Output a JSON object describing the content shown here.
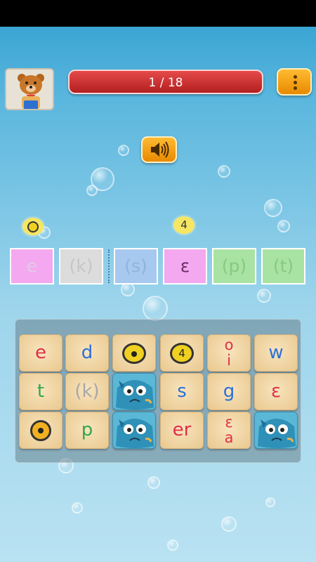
{
  "progress": {
    "label": "1 / 18",
    "current": 1,
    "total": 18
  },
  "hints": [
    {
      "id": "dot",
      "text": ""
    },
    {
      "id": "tone",
      "text": "4"
    }
  ],
  "answer_slots": [
    {
      "text": "e",
      "bg": "#f3a8f0",
      "fg": "#e6c9e4"
    },
    {
      "text": "(k)",
      "bg": "#dcdcdc",
      "fg": "#c6c6c6"
    },
    {
      "text": "(s)",
      "bg": "#a7c9f0",
      "fg": "#8fb4de"
    },
    {
      "text": "ε",
      "bg": "#f3a8f0",
      "fg": "#6a2f66"
    },
    {
      "text": "(p)",
      "bg": "#a9e3a3",
      "fg": "#86c983"
    },
    {
      "text": "(t)",
      "bg": "#a9e3a3",
      "fg": "#86c983"
    }
  ],
  "tiles": [
    {
      "type": "text",
      "text": "e",
      "color": "#e0304a"
    },
    {
      "type": "text",
      "text": "d",
      "color": "#2d6fd8"
    },
    {
      "type": "dot"
    },
    {
      "type": "tone",
      "text": "4"
    },
    {
      "type": "stack",
      "top": "o",
      "bottom": "i",
      "color": "#e0304a"
    },
    {
      "type": "text",
      "text": "w",
      "color": "#2d6fd8"
    },
    {
      "type": "text",
      "text": "t",
      "color": "#2fa84a"
    },
    {
      "type": "text",
      "text": "(k)",
      "color": "#a8a8a8"
    },
    {
      "type": "fish"
    },
    {
      "type": "text",
      "text": "s",
      "color": "#2d6fd8"
    },
    {
      "type": "text",
      "text": "g",
      "color": "#2d6fd8"
    },
    {
      "type": "text",
      "text": "ε",
      "color": "#e0304a"
    },
    {
      "type": "dotsmall"
    },
    {
      "type": "text",
      "text": "p",
      "color": "#2fa84a"
    },
    {
      "type": "fish"
    },
    {
      "type": "text",
      "text": "er",
      "color": "#e0304a"
    },
    {
      "type": "stack",
      "top": "ε",
      "bottom": "a",
      "color": "#e0304a"
    },
    {
      "type": "fish"
    }
  ]
}
